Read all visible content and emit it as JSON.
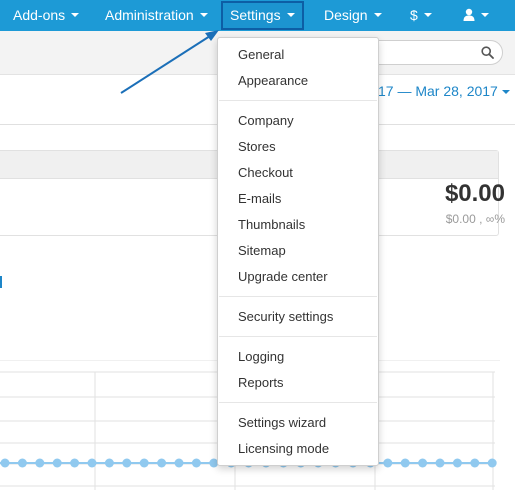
{
  "navbar": {
    "items": [
      {
        "label": "Add-ons"
      },
      {
        "label": "Administration"
      },
      {
        "label": "Settings"
      },
      {
        "label": "Design"
      },
      {
        "label": "$"
      },
      {
        "icon": "user-icon"
      }
    ],
    "active": "Settings",
    "accent": "#1d9ad6"
  },
  "header": {
    "date_range": "17 — Mar 28, 2017"
  },
  "summary": {
    "amount": "$0.00",
    "amount_sub": "$0.00 , ∞%"
  },
  "settings_menu": {
    "groups": [
      [
        "General",
        "Appearance"
      ],
      [
        "Company",
        "Stores",
        "Checkout",
        "E-mails",
        "Thumbnails",
        "Sitemap",
        "Upgrade center"
      ],
      [
        "Security settings"
      ],
      [
        "Logging",
        "Reports"
      ],
      [
        "Settings wizard",
        "Licensing mode"
      ]
    ]
  },
  "colors": {
    "link": "#1d86c8",
    "chart_point": "#90c9ef"
  }
}
